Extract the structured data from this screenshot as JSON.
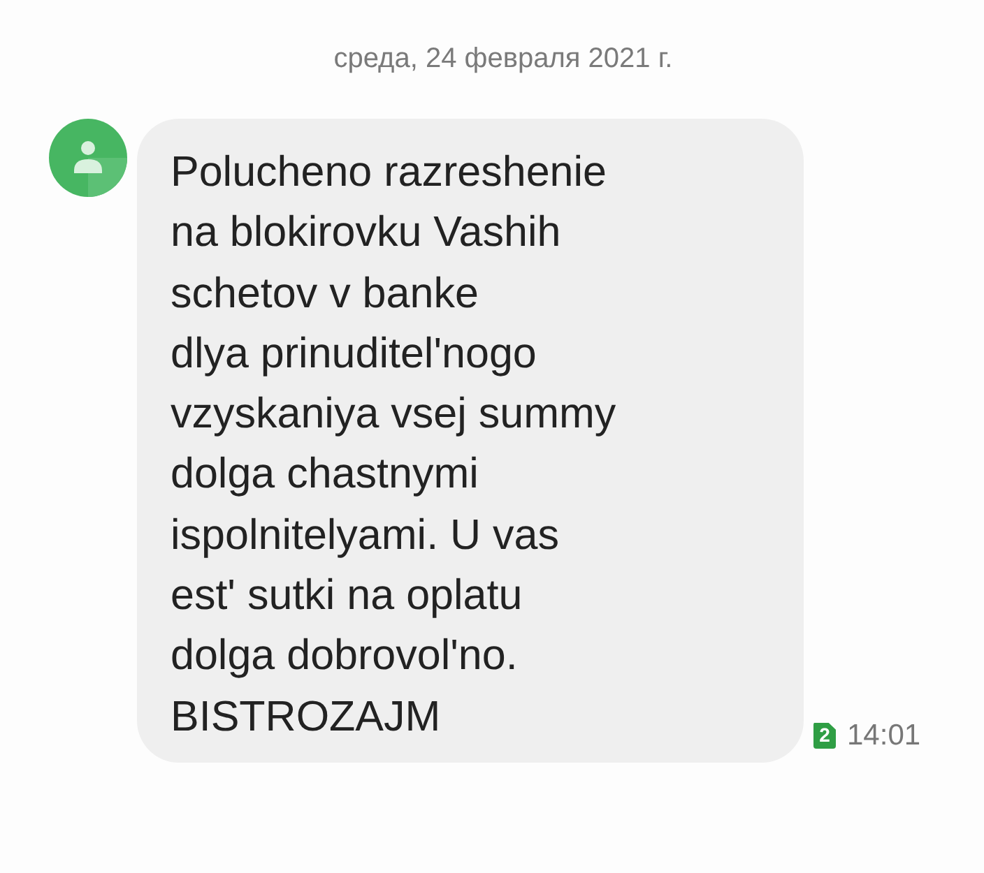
{
  "date_header": "среда, 24 февраля 2021 г.",
  "message": {
    "text": "Polucheno razreshenie\nna blokirovku Vashih\nschetov v banke\ndlya prinuditel'nogo\nvzyskaniya vsej summy\ndolga chastnymi\nispolnitelyami. U vas\nest' sutki na oplatu\ndolga dobrovol'no.\nBISTROZAJM",
    "sim": "2",
    "time": "14:01"
  }
}
